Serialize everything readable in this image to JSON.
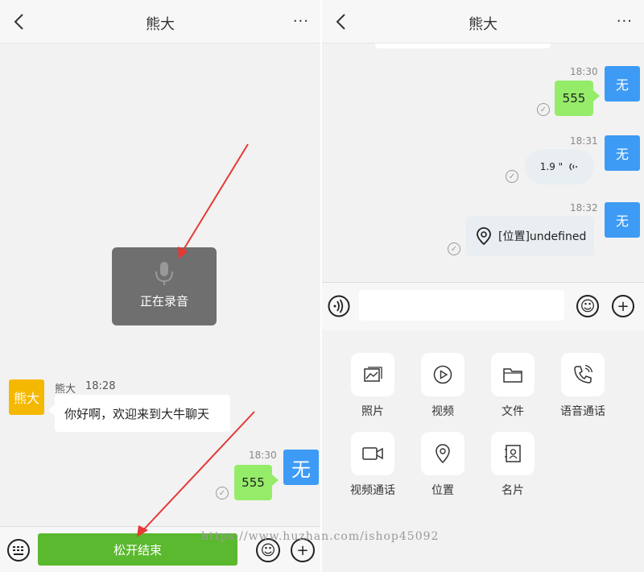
{
  "left": {
    "title": "熊大",
    "more": "···",
    "recording": {
      "text": "正在录音"
    },
    "incoming": {
      "avatar_text": "熊大",
      "sender": "熊大",
      "time": "18:28",
      "text": "你好啊，欢迎来到大牛聊天"
    },
    "outgoing": {
      "time": "18:30",
      "text": "555",
      "avatar_text": "无"
    },
    "bottom": {
      "record_button": "松开结束"
    }
  },
  "right": {
    "title": "熊大",
    "more": "···",
    "messages": [
      {
        "time": "18:30",
        "text": "555",
        "avatar_text": "无"
      },
      {
        "time": "18:31",
        "voice_duration": "1.9 \"",
        "avatar_text": "无"
      },
      {
        "time": "18:32",
        "location_text": "[位置]undefined",
        "avatar_text": "无"
      }
    ],
    "panel": [
      {
        "label": "照片",
        "icon": "photo-icon"
      },
      {
        "label": "视频",
        "icon": "video-play-icon"
      },
      {
        "label": "文件",
        "icon": "folder-icon"
      },
      {
        "label": "语音通话",
        "icon": "phone-call-icon"
      },
      {
        "label": "视频通话",
        "icon": "video-camera-icon"
      },
      {
        "label": "位置",
        "icon": "location-pin-icon"
      },
      {
        "label": "名片",
        "icon": "contact-card-icon"
      }
    ]
  },
  "watermark": "https://www.huzhan.com/ishop45092",
  "colors": {
    "green_bubble": "#95ec69",
    "record_button": "#5ab92e",
    "blue_avatar": "#3d9bf5",
    "yellow_avatar": "#f5b800",
    "arrow": "#e53935"
  }
}
